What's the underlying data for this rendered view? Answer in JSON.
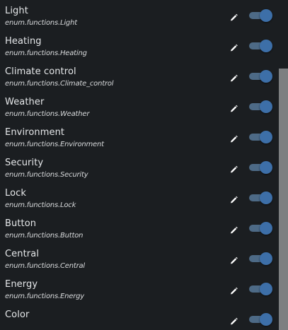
{
  "functions": [
    {
      "name": "Light",
      "id": "enum.functions.Light",
      "enabled": true
    },
    {
      "name": "Heating",
      "id": "enum.functions.Heating",
      "enabled": true
    },
    {
      "name": "Climate control",
      "id": "enum.functions.Climate_control",
      "enabled": true
    },
    {
      "name": "Weather",
      "id": "enum.functions.Weather",
      "enabled": true
    },
    {
      "name": "Environment",
      "id": "enum.functions.Environment",
      "enabled": true
    },
    {
      "name": "Security",
      "id": "enum.functions.Security",
      "enabled": true
    },
    {
      "name": "Lock",
      "id": "enum.functions.Lock",
      "enabled": true
    },
    {
      "name": "Button",
      "id": "enum.functions.Button",
      "enabled": true
    },
    {
      "name": "Central",
      "id": "enum.functions.Central",
      "enabled": true
    },
    {
      "name": "Energy",
      "id": "enum.functions.Energy",
      "enabled": true
    },
    {
      "name": "Color",
      "id": "",
      "enabled": true
    }
  ],
  "icons": {
    "edit": "pencil-icon"
  },
  "colors": {
    "background": "#1b1e21",
    "text": "#e6e8ea",
    "toggle_track": "#4d6a86",
    "toggle_knob": "#3d6fa8",
    "scrollbar_thumb": "#7d7f81"
  }
}
